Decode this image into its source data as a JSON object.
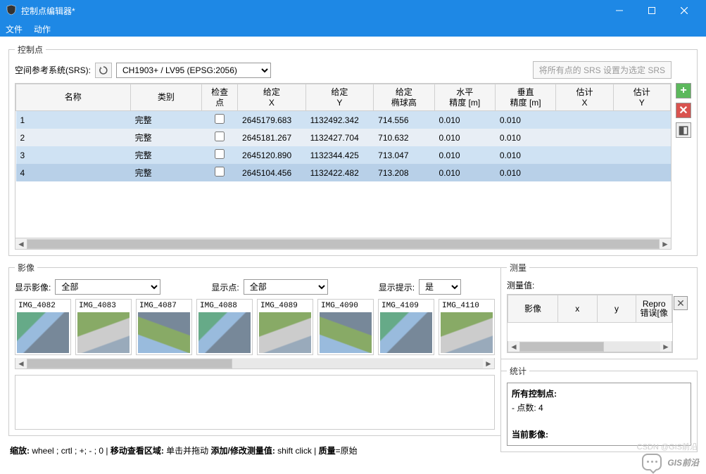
{
  "window": {
    "title": "控制点编辑器*"
  },
  "menu": {
    "file": "文件",
    "action": "动作"
  },
  "cp": {
    "legend": "控制点",
    "srs_label": "空间参考系统(SRS):",
    "srs_value": "CH1903+ / LV95 (EPSG:2056)",
    "apply_srs": "将所有点的 SRS 设置为选定 SRS",
    "cols": {
      "name": "名称",
      "type": "类别",
      "check": "检查\n点",
      "gx": "给定\nX",
      "gy": "给定\nY",
      "gz": "给定\n椭球高",
      "hacc": "水平\n精度 [m]",
      "vacc": "垂直\n精度 [m]",
      "ex": "估计\nX",
      "ey": "估计\nY"
    },
    "rows": [
      {
        "name": "1",
        "type": "完整",
        "check": false,
        "gx": "2645179.683",
        "gy": "1132492.342",
        "gz": "714.556",
        "hacc": "0.010",
        "vacc": "0.010"
      },
      {
        "name": "2",
        "type": "完整",
        "check": false,
        "gx": "2645181.267",
        "gy": "1132427.704",
        "gz": "710.632",
        "hacc": "0.010",
        "vacc": "0.010"
      },
      {
        "name": "3",
        "type": "完整",
        "check": false,
        "gx": "2645120.890",
        "gy": "1132344.425",
        "gz": "713.047",
        "hacc": "0.010",
        "vacc": "0.010"
      },
      {
        "name": "4",
        "type": "完整",
        "check": false,
        "gx": "2645104.456",
        "gy": "1132422.482",
        "gz": "713.208",
        "hacc": "0.010",
        "vacc": "0.010"
      }
    ]
  },
  "images": {
    "legend": "影像",
    "show_img_label": "显示影像:",
    "show_img_value": "全部",
    "show_pt_label": "显示点:",
    "show_pt_value": "全部",
    "show_hint_label": "显示提示:",
    "show_hint_value": "是",
    "thumbs": [
      "IMG_4082",
      "IMG_4083",
      "IMG_4087",
      "IMG_4088",
      "IMG_4089",
      "IMG_4090",
      "IMG_4109",
      "IMG_4110"
    ]
  },
  "hints": {
    "zoom_b": "缩放:",
    "zoom_t": " wheel ; crtl ; +; - ; 0 | ",
    "pan_b": "移动查看区域:",
    "pan_t": " 单击并拖动   ",
    "add_b": "添加/修改测量值:",
    "add_t": " shift click | ",
    "q_b": "质量",
    "q_t": "=原始"
  },
  "meas": {
    "legend": "测量",
    "value_label": "测量值:",
    "cols": {
      "img": "影像",
      "x": "x",
      "y": "y",
      "repro": "Repro\n错误[像"
    }
  },
  "stats": {
    "legend": "统计",
    "all_b": "所有控制点:",
    "count": "- 点数: 4",
    "cur_b": "当前影像:"
  },
  "watermark": {
    "text": "GIS前沿",
    "csdn": "CSDN @GIS前沿"
  }
}
